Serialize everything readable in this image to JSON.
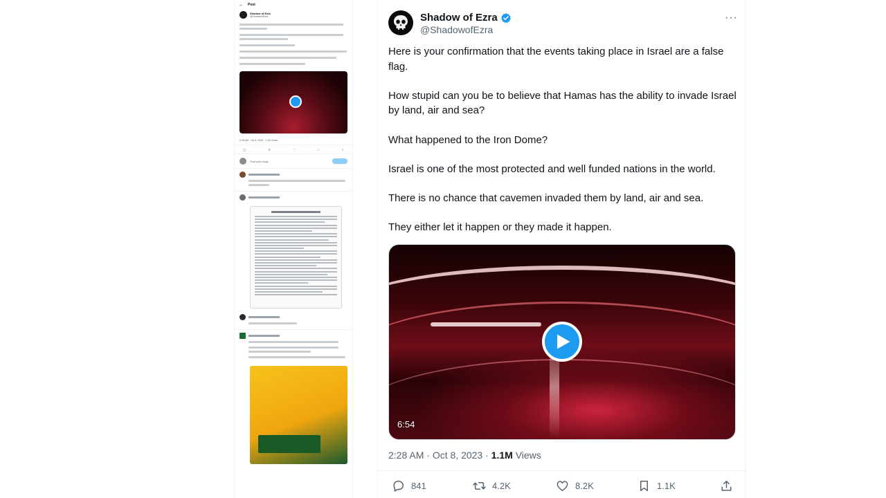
{
  "thumbnail": {
    "top_label": "Post",
    "author_name": "Shadow of Ezra",
    "author_handle": "@ShadowofEzra",
    "reply_placeholder": "Post your reply",
    "reply_button": "Reply",
    "meta": "2:28 AM · Oct 8, 2023 · 1.1M Views"
  },
  "tweet": {
    "author": {
      "display_name": "Shadow of Ezra",
      "handle": "@ShadowofEzra",
      "verified_icon": "verified-badge-icon"
    },
    "more_label": "···",
    "paragraphs": [
      "Here is your confirmation that the events taking place in Israel are a false flag.",
      "How stupid can you be to believe that Hamas has the ability to invade Israel by land, air and sea?",
      "What happened to the Iron Dome?",
      "Israel is one of the most protected and well funded nations in the world.",
      "There is no chance that cavemen invaded them by land, air and sea.",
      "They either let it happen or they made it happen."
    ],
    "video": {
      "duration": "6:54",
      "play_icon": "play-icon"
    },
    "time": "2:28 AM",
    "date": "Oct 8, 2023",
    "views_count": "1.1M",
    "views_label": "Views",
    "actions": {
      "replies": "841",
      "reposts": "4.2K",
      "likes": "8.2K",
      "bookmarks": "1.1K"
    }
  },
  "colors": {
    "accent": "#1d9bf0",
    "text_secondary": "#536471",
    "text_primary": "#0f1419"
  }
}
